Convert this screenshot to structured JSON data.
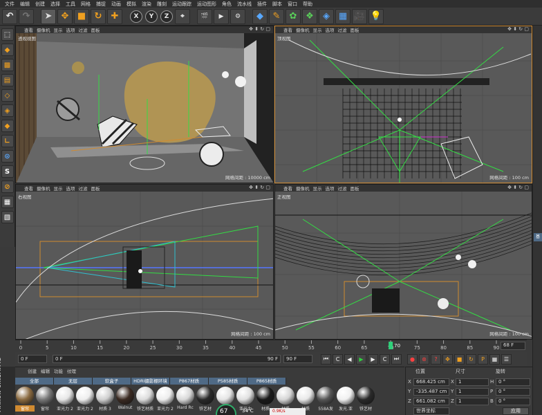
{
  "menu": [
    "文件",
    "编辑",
    "创建",
    "选择",
    "工具",
    "网格",
    "捕捉",
    "动画",
    "模拟",
    "渲染",
    "雕刻",
    "运动跟踪",
    "运动图形",
    "角色",
    "流水线",
    "插件",
    "脚本",
    "窗口",
    "帮助"
  ],
  "toolbar": {
    "axis_x": "X",
    "axis_y": "Y",
    "axis_z": "Z"
  },
  "viewport_menu": [
    "查看",
    "摄像机",
    "显示",
    "选项",
    "过滤",
    "面板"
  ],
  "viewports": {
    "perspective": {
      "label": "透视视图",
      "grid": "网格间距 : 10000 cm"
    },
    "top": {
      "label": "顶视图",
      "grid": "网格间距 : 100 cm"
    },
    "right": {
      "label": "右视图",
      "grid": "网格间距 : 100 cm"
    },
    "front": {
      "label": "正视图",
      "grid": "网格间距 : 100 cm"
    }
  },
  "timeline": {
    "ticks": [
      "0",
      "5",
      "10",
      "15",
      "20",
      "25",
      "30",
      "35",
      "40",
      "45",
      "50",
      "55",
      "60",
      "65",
      "70",
      "75",
      "80",
      "85",
      "90"
    ],
    "current_frame": "70",
    "end_frame": "68 F"
  },
  "transport": {
    "start_field": "0 F",
    "preview_start": "0 F",
    "preview_end": "90 F",
    "end_field": "90 F"
  },
  "material_panel": {
    "menu": [
      "创建",
      "编辑",
      "功能",
      "纹理"
    ],
    "tabs": [
      "全部",
      "无层",
      "软盒子",
      "HDRI摄影棚环境",
      "P867材质",
      "P585材质",
      "P865材质"
    ],
    "materials": [
      {
        "name": "窗帘",
        "color": "#8a6a40",
        "selected": true
      },
      {
        "name": "窗帘",
        "color": "#777777",
        "selected": false
      },
      {
        "name": "亚光力 2",
        "color": "#e6e6e6",
        "selected": false
      },
      {
        "name": "亚光力 2",
        "color": "#eeeeee",
        "selected": false
      },
      {
        "name": "材质 3",
        "color": "#cfcfcf",
        "selected": false
      },
      {
        "name": "Walnut",
        "color": "#3a2a22",
        "selected": false
      },
      {
        "name": "铁艺材质",
        "color": "#dcdcdc",
        "selected": false
      },
      {
        "name": "亚光力 2",
        "color": "#ededed",
        "selected": false
      },
      {
        "name": "Hard Rc",
        "color": "#d8d8d8",
        "selected": false
      },
      {
        "name": "铁艺材",
        "color": "#2a2a2a",
        "selected": false
      },
      {
        "name": "亚光力",
        "color": "#e4e4e4",
        "selected": false
      },
      {
        "name": "亚光力",
        "color": "#e0e0e0",
        "selected": false
      },
      {
        "name": "材质",
        "color": "#1a1a1a",
        "selected": false
      },
      {
        "name": "材质",
        "color": "#d6d6d6",
        "selected": false
      },
      {
        "name": "材质",
        "color": "#e8e8e8",
        "selected": false
      },
      {
        "name": "558A发",
        "color": "#555555",
        "selected": false
      },
      {
        "name": "发光.亚",
        "color": "#f0f0f0",
        "selected": false
      },
      {
        "name": "铁艺材",
        "color": "#2a2a2a",
        "selected": false
      }
    ]
  },
  "coords": {
    "headers": {
      "position": "位置",
      "size": "尺寸",
      "rotation": "旋转"
    },
    "rows": [
      {
        "axis": "X",
        "pos": "668.425 cm",
        "size": "1",
        "rot_axis": "H",
        "rot": "0 °"
      },
      {
        "axis": "Y",
        "pos": "-335.487 cm",
        "size": "1",
        "rot_axis": "P",
        "rot": "0 °"
      },
      {
        "axis": "Z",
        "pos": "661.082 cm",
        "size": "1",
        "rot_axis": "B",
        "rot": "0 °"
      }
    ],
    "mode": "世界坐标",
    "apply": "应用"
  },
  "right_strip": [
    "基"
  ],
  "hud": {
    "percent": "67",
    "temp": "34℃",
    "net": "0.9K/s"
  }
}
